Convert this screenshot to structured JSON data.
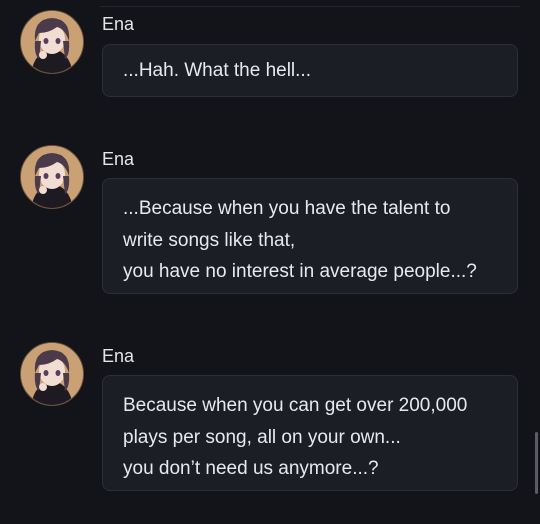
{
  "messages": [
    {
      "author": "Ena",
      "avatar_icon": "ena-portrait-avatar",
      "lines": [
        "...Hah. What the hell..."
      ]
    },
    {
      "author": "Ena",
      "avatar_icon": "ena-portrait-avatar",
      "lines": [
        "...Because when you have the talent to",
        "write songs like that,",
        "you have no interest in average people...?"
      ]
    },
    {
      "author": "Ena",
      "avatar_icon": "ena-portrait-avatar",
      "lines": [
        "Because when you can get over 200,000",
        "plays per song, all on your own...",
        "you don’t need us anymore...?"
      ]
    }
  ],
  "colors": {
    "background": "#131419",
    "bubble": "#1c1e26",
    "bubble_border": "#2c2f39",
    "text": "#e8e9ee"
  }
}
